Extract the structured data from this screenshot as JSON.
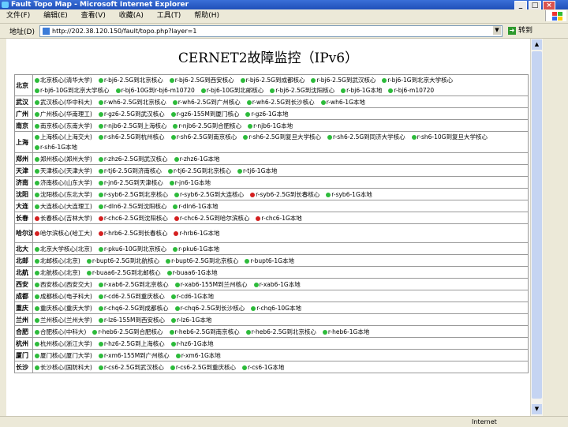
{
  "window": {
    "title": "Fault Topo Map - Microsoft Internet Explorer",
    "controls": [
      "_",
      "□",
      "×"
    ]
  },
  "menu": [
    "文件(F)",
    "编辑(E)",
    "查看(V)",
    "收藏(A)",
    "工具(T)",
    "帮助(H)"
  ],
  "address": {
    "label": "地址(D)",
    "url": "http://202.38.120.150/fault/topo.php?layer=1",
    "go_label": "转到"
  },
  "page": {
    "title": "CERNET2故障监控（IPv6）",
    "rows": [
      {
        "city": "北京",
        "tall": true,
        "links": [
          {
            "label": "北京核心(清华大学)",
            "status": "up"
          },
          {
            "label": "r-bj6-2.5G到北京核心",
            "status": "up"
          },
          {
            "label": "r-bj6-2.5G到西安核心",
            "status": "up"
          },
          {
            "label": "r-bj6-2.5G到成都核心",
            "status": "up"
          },
          {
            "label": "r-bj6-2.5G到武汉核心",
            "status": "up"
          },
          {
            "label": "r-bj6-1G到北京大学核心",
            "status": "up"
          },
          {
            "label": "r-bj6-10G到北京大学核心",
            "status": "up"
          },
          {
            "label": "r-bj6-10G到r-bj6-m10720",
            "status": "up"
          },
          {
            "label": "r-bj6-10G到北邮核心",
            "status": "up"
          },
          {
            "label": "r-bj6-2.5G到沈阳核心",
            "status": "up"
          },
          {
            "label": "r-bj6-1G本地",
            "status": "up"
          },
          {
            "label": "r-bj6-m10720",
            "status": "up"
          }
        ]
      },
      {
        "city": "武汉",
        "links": [
          {
            "label": "武汉核心(华中科大)",
            "status": "up"
          },
          {
            "label": "r-wh6-2.5G到北京核心",
            "status": "up"
          },
          {
            "label": "r-wh6-2.5G到广州核心",
            "status": "up"
          },
          {
            "label": "r-wh6-2.5G到长沙核心",
            "status": "up"
          },
          {
            "label": "r-wh6-1G本地",
            "status": "up"
          }
        ]
      },
      {
        "city": "广州",
        "links": [
          {
            "label": "广州核心(华南理工)",
            "status": "up"
          },
          {
            "label": "r-gz6-2.5G到武汉核心",
            "status": "up"
          },
          {
            "label": "r-gz6-155M到厦门核心",
            "status": "up"
          },
          {
            "label": "r-gz6-1G本地",
            "status": "up"
          }
        ]
      },
      {
        "city": "南京",
        "links": [
          {
            "label": "南京核心(东南大学)",
            "status": "up"
          },
          {
            "label": "r-njb6-2.5G到上海核心",
            "status": "up"
          },
          {
            "label": "r-njb6-2.5G到合肥核心",
            "status": "up"
          },
          {
            "label": "r-njb6-1G本地",
            "status": "up"
          }
        ]
      },
      {
        "city": "上海",
        "tall": true,
        "links": [
          {
            "label": "上海核心(上海交大)",
            "status": "up"
          },
          {
            "label": "r-sh6-2.5G到杭州核心",
            "status": "up"
          },
          {
            "label": "r-sh6-2.5G到南京核心",
            "status": "up"
          },
          {
            "label": "r-sh6-2.5G到复旦大学核心",
            "status": "up"
          },
          {
            "label": "r-sh6-2.5G到同济大学核心",
            "status": "up"
          },
          {
            "label": "r-sh6-10G到复旦大学核心",
            "status": "up"
          },
          {
            "label": "r-sh6-1G本地",
            "status": "up"
          }
        ]
      },
      {
        "city": "郑州",
        "links": [
          {
            "label": "郑州核心(郑州大学)",
            "status": "up"
          },
          {
            "label": "r-zhz6-2.5G到武汉核心",
            "status": "up"
          },
          {
            "label": "r-zhz6-1G本地",
            "status": "up"
          }
        ]
      },
      {
        "city": "天津",
        "links": [
          {
            "label": "天津核心(天津大学)",
            "status": "up"
          },
          {
            "label": "r-tj6-2.5G到济南核心",
            "status": "up"
          },
          {
            "label": "r-tj6-2.5G到北京核心",
            "status": "up"
          },
          {
            "label": "r-tj6-1G本地",
            "status": "up"
          }
        ]
      },
      {
        "city": "济南",
        "links": [
          {
            "label": "济南核心(山东大学)",
            "status": "up"
          },
          {
            "label": "r-jn6-2.5G到天津核心",
            "status": "up"
          },
          {
            "label": "r-jn6-1G本地",
            "status": "up"
          }
        ]
      },
      {
        "city": "沈阳",
        "links": [
          {
            "label": "沈阳核心(东北大学)",
            "status": "up"
          },
          {
            "label": "r-syb6-2.5G到北京核心",
            "status": "up"
          },
          {
            "label": "r-syb6-2.5G到大连核心",
            "status": "up"
          },
          {
            "label": "r-syb6-2.5G到长春核心",
            "status": "down"
          },
          {
            "label": "r-syb6-1G本地",
            "status": "up"
          }
        ]
      },
      {
        "city": "大连",
        "links": [
          {
            "label": "大连核心(大连理工)",
            "status": "up"
          },
          {
            "label": "r-dln6-2.5G到沈阳核心",
            "status": "up"
          },
          {
            "label": "r-dln6-1G本地",
            "status": "up"
          }
        ]
      },
      {
        "city": "长春",
        "links": [
          {
            "label": "长春核心(吉林大学)",
            "status": "down"
          },
          {
            "label": "r-chc6-2.5G到沈阳核心",
            "status": "down"
          },
          {
            "label": "r-chc6-2.5G到哈尔滨核心",
            "status": "down"
          },
          {
            "label": "r-chc6-1G本地",
            "status": "down"
          }
        ]
      },
      {
        "city": "哈尔滨",
        "tall": true,
        "links": [
          {
            "label": "哈尔滨核心(哈工大)",
            "status": "down"
          },
          {
            "label": "r-hrb6-2.5G到长春核心",
            "status": "down"
          },
          {
            "label": "r-hrb6-1G本地",
            "status": "down"
          }
        ]
      },
      {
        "city": "北大",
        "links": [
          {
            "label": "北京大学核心(北京)",
            "status": "up"
          },
          {
            "label": "r-pku6-10G到北京核心",
            "status": "up"
          },
          {
            "label": "r-pku6-1G本地",
            "status": "up"
          }
        ]
      },
      {
        "city": "北邮",
        "links": [
          {
            "label": "北邮核心(北京)",
            "status": "up"
          },
          {
            "label": "r-bupt6-2.5G到北航核心",
            "status": "up"
          },
          {
            "label": "r-bupt6-2.5G到北京核心",
            "status": "up"
          },
          {
            "label": "r-bupt6-1G本地",
            "status": "up"
          }
        ]
      },
      {
        "city": "北航",
        "links": [
          {
            "label": "北航核心(北京)",
            "status": "up"
          },
          {
            "label": "r-buaa6-2.5G到北邮核心",
            "status": "up"
          },
          {
            "label": "r-buaa6-1G本地",
            "status": "up"
          }
        ]
      },
      {
        "city": "西安",
        "links": [
          {
            "label": "西安核心(西安交大)",
            "status": "up"
          },
          {
            "label": "r-xab6-2.5G到北京核心",
            "status": "up"
          },
          {
            "label": "r-xab6-155M到兰州核心",
            "status": "up"
          },
          {
            "label": "r-xab6-1G本地",
            "status": "up"
          }
        ]
      },
      {
        "city": "成都",
        "links": [
          {
            "label": "成都核心(电子科大)",
            "status": "up"
          },
          {
            "label": "r-cd6-2.5G到重庆核心",
            "status": "up"
          },
          {
            "label": "r-cd6-1G本地",
            "status": "up"
          }
        ]
      },
      {
        "city": "重庆",
        "links": [
          {
            "label": "重庆核心(重庆大学)",
            "status": "up"
          },
          {
            "label": "r-chq6-2.5G到成都核心",
            "status": "up"
          },
          {
            "label": "r-chq6-2.5G到长沙核心",
            "status": "up"
          },
          {
            "label": "r-chq6-10G本地",
            "status": "up"
          }
        ]
      },
      {
        "city": "兰州",
        "links": [
          {
            "label": "兰州核心(兰州大学)",
            "status": "up"
          },
          {
            "label": "r-lz6-155M到西安核心",
            "status": "up"
          },
          {
            "label": "r-lz6-1G本地",
            "status": "up"
          }
        ]
      },
      {
        "city": "合肥",
        "links": [
          {
            "label": "合肥核心(中科大)",
            "status": "up"
          },
          {
            "label": "r-heb6-2.5G到合肥核心",
            "status": "up"
          },
          {
            "label": "r-heb6-2.5G到南京核心",
            "status": "up"
          },
          {
            "label": "r-heb6-2.5G到北京核心",
            "status": "up"
          },
          {
            "label": "r-heb6-1G本地",
            "status": "up"
          }
        ]
      },
      {
        "city": "杭州",
        "links": [
          {
            "label": "杭州核心(浙江大学)",
            "status": "up"
          },
          {
            "label": "r-hz6-2.5G到上海核心",
            "status": "up"
          },
          {
            "label": "r-hz6-1G本地",
            "status": "up"
          }
        ]
      },
      {
        "city": "厦门",
        "links": [
          {
            "label": "厦门核心(厦门大学)",
            "status": "up"
          },
          {
            "label": "r-xm6-155M到广州核心",
            "status": "up"
          },
          {
            "label": "r-xm6-1G本地",
            "status": "up"
          }
        ]
      },
      {
        "city": "长沙",
        "links": [
          {
            "label": "长沙核心(国防科大)",
            "status": "up"
          },
          {
            "label": "r-cs6-2.5G到武汉核心",
            "status": "up"
          },
          {
            "label": "r-cs6-2.5G到重庆核心",
            "status": "up"
          },
          {
            "label": "r-cs6-1G本地",
            "status": "up"
          }
        ]
      }
    ]
  },
  "status_bar": {
    "zone": "Internet"
  },
  "colors": {
    "status_up": "#2dbb3b",
    "status_down": "#d42020",
    "titlebar": "#1f4fb8"
  }
}
